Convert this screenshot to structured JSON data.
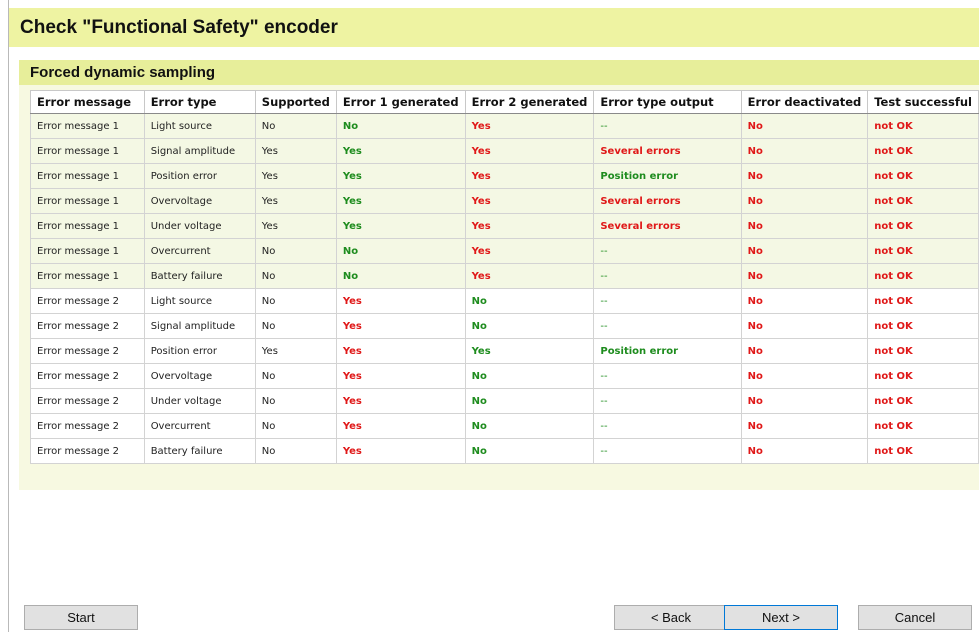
{
  "title": "Check \"Functional Safety\" encoder",
  "section": {
    "label": "Forced dynamic sampling"
  },
  "table": {
    "headers": [
      "Error message",
      "Error type",
      "Supported",
      "Error 1 generated",
      "Error 2 generated",
      "Error type output",
      "Error deactivated",
      "Test successful"
    ],
    "rows": [
      {
        "shade": "g",
        "cells": [
          [
            "Error message 1",
            ""
          ],
          [
            "Light source",
            ""
          ],
          [
            "No",
            ""
          ],
          [
            "No",
            "ok"
          ],
          [
            "Yes",
            "bad"
          ],
          [
            "--",
            "dash"
          ],
          [
            "No",
            "bad"
          ],
          [
            "not OK",
            "bad"
          ]
        ]
      },
      {
        "shade": "g",
        "cells": [
          [
            "Error message 1",
            ""
          ],
          [
            "Signal amplitude",
            ""
          ],
          [
            "Yes",
            ""
          ],
          [
            "Yes",
            "ok"
          ],
          [
            "Yes",
            "bad"
          ],
          [
            "Several errors",
            "bad"
          ],
          [
            "No",
            "bad"
          ],
          [
            "not OK",
            "bad"
          ]
        ]
      },
      {
        "shade": "g",
        "cells": [
          [
            "Error message 1",
            ""
          ],
          [
            "Position error",
            ""
          ],
          [
            "Yes",
            ""
          ],
          [
            "Yes",
            "ok"
          ],
          [
            "Yes",
            "bad"
          ],
          [
            "Position error",
            "ok"
          ],
          [
            "No",
            "bad"
          ],
          [
            "not OK",
            "bad"
          ]
        ]
      },
      {
        "shade": "g",
        "cells": [
          [
            "Error message 1",
            ""
          ],
          [
            "Overvoltage",
            ""
          ],
          [
            "Yes",
            ""
          ],
          [
            "Yes",
            "ok"
          ],
          [
            "Yes",
            "bad"
          ],
          [
            "Several errors",
            "bad"
          ],
          [
            "No",
            "bad"
          ],
          [
            "not OK",
            "bad"
          ]
        ]
      },
      {
        "shade": "g",
        "cells": [
          [
            "Error message 1",
            ""
          ],
          [
            "Under voltage",
            ""
          ],
          [
            "Yes",
            ""
          ],
          [
            "Yes",
            "ok"
          ],
          [
            "Yes",
            "bad"
          ],
          [
            "Several errors",
            "bad"
          ],
          [
            "No",
            "bad"
          ],
          [
            "not OK",
            "bad"
          ]
        ]
      },
      {
        "shade": "g",
        "cells": [
          [
            "Error message 1",
            ""
          ],
          [
            "Overcurrent",
            ""
          ],
          [
            "No",
            ""
          ],
          [
            "No",
            "ok"
          ],
          [
            "Yes",
            "bad"
          ],
          [
            "--",
            "dash"
          ],
          [
            "No",
            "bad"
          ],
          [
            "not OK",
            "bad"
          ]
        ]
      },
      {
        "shade": "g",
        "cells": [
          [
            "Error message 1",
            ""
          ],
          [
            "Battery failure",
            ""
          ],
          [
            "No",
            ""
          ],
          [
            "No",
            "ok"
          ],
          [
            "Yes",
            "bad"
          ],
          [
            "--",
            "dash"
          ],
          [
            "No",
            "bad"
          ],
          [
            "not OK",
            "bad"
          ]
        ]
      },
      {
        "shade": "w",
        "cells": [
          [
            "Error message 2",
            ""
          ],
          [
            "Light source",
            ""
          ],
          [
            "No",
            ""
          ],
          [
            "Yes",
            "bad"
          ],
          [
            "No",
            "ok"
          ],
          [
            "--",
            "dash"
          ],
          [
            "No",
            "bad"
          ],
          [
            "not OK",
            "bad"
          ]
        ]
      },
      {
        "shade": "w",
        "cells": [
          [
            "Error message 2",
            ""
          ],
          [
            "Signal amplitude",
            ""
          ],
          [
            "No",
            ""
          ],
          [
            "Yes",
            "bad"
          ],
          [
            "No",
            "ok"
          ],
          [
            "--",
            "dash"
          ],
          [
            "No",
            "bad"
          ],
          [
            "not OK",
            "bad"
          ]
        ]
      },
      {
        "shade": "w",
        "cells": [
          [
            "Error message 2",
            ""
          ],
          [
            "Position error",
            ""
          ],
          [
            "Yes",
            ""
          ],
          [
            "Yes",
            "bad"
          ],
          [
            "Yes",
            "ok"
          ],
          [
            "Position error",
            "ok"
          ],
          [
            "No",
            "bad"
          ],
          [
            "not OK",
            "bad"
          ]
        ]
      },
      {
        "shade": "w",
        "cells": [
          [
            "Error message 2",
            ""
          ],
          [
            "Overvoltage",
            ""
          ],
          [
            "No",
            ""
          ],
          [
            "Yes",
            "bad"
          ],
          [
            "No",
            "ok"
          ],
          [
            "--",
            "dash"
          ],
          [
            "No",
            "bad"
          ],
          [
            "not OK",
            "bad"
          ]
        ]
      },
      {
        "shade": "w",
        "cells": [
          [
            "Error message 2",
            ""
          ],
          [
            "Under voltage",
            ""
          ],
          [
            "No",
            ""
          ],
          [
            "Yes",
            "bad"
          ],
          [
            "No",
            "ok"
          ],
          [
            "--",
            "dash"
          ],
          [
            "No",
            "bad"
          ],
          [
            "not OK",
            "bad"
          ]
        ]
      },
      {
        "shade": "w",
        "cells": [
          [
            "Error message 2",
            ""
          ],
          [
            "Overcurrent",
            ""
          ],
          [
            "No",
            ""
          ],
          [
            "Yes",
            "bad"
          ],
          [
            "No",
            "ok"
          ],
          [
            "--",
            "dash"
          ],
          [
            "No",
            "bad"
          ],
          [
            "not OK",
            "bad"
          ]
        ]
      },
      {
        "shade": "w",
        "cells": [
          [
            "Error message 2",
            ""
          ],
          [
            "Battery failure",
            ""
          ],
          [
            "No",
            ""
          ],
          [
            "Yes",
            "bad"
          ],
          [
            "No",
            "ok"
          ],
          [
            "--",
            "dash"
          ],
          [
            "No",
            "bad"
          ],
          [
            "not OK",
            "bad"
          ]
        ]
      }
    ]
  },
  "buttons": {
    "start": "Start",
    "back": "< Back",
    "next": "Next >",
    "cancel": "Cancel"
  },
  "colors": {
    "title_bg": "#eef3a2",
    "section_bg": "#e7ee9a",
    "ok": "#1e8c1e",
    "bad": "#e01818"
  }
}
